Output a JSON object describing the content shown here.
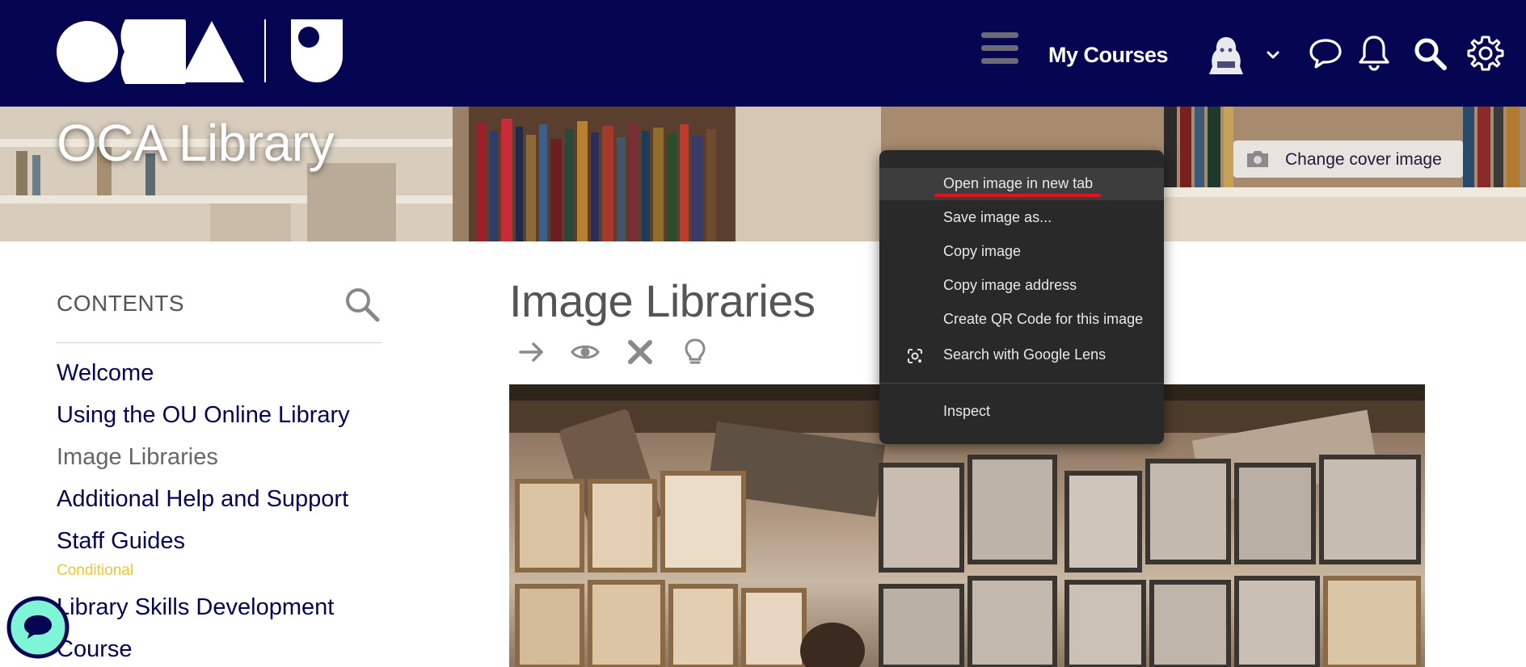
{
  "header": {
    "my_courses_label": "My Courses",
    "brand_color": "#050552"
  },
  "banner": {
    "title": "OCA Library",
    "change_cover_label": "Change cover image"
  },
  "sidebar": {
    "contents_title": "CONTENTS",
    "items": [
      {
        "label": "Welcome"
      },
      {
        "label": "Using the OU Online Library"
      },
      {
        "label": "Image Libraries",
        "current": true
      },
      {
        "label": "Additional Help and Support"
      },
      {
        "label": "Staff Guides",
        "badge": "Conditional"
      },
      {
        "label": "Library Skills Development"
      },
      {
        "label": "Course"
      }
    ]
  },
  "main": {
    "title": "Image Libraries",
    "actions": [
      "arrow-right-icon",
      "eye-icon",
      "close-icon",
      "lightbulb-icon"
    ]
  },
  "context_menu": {
    "items": [
      {
        "label": "Open image in new tab",
        "highlighted": true
      },
      {
        "label": "Save image as..."
      },
      {
        "label": "Copy image"
      },
      {
        "label": "Copy image address"
      },
      {
        "label": "Create QR Code for this image"
      },
      {
        "label": "Search with Google Lens",
        "icon": "google-lens-icon"
      },
      {
        "label": "Inspect"
      }
    ],
    "underline_color": "#e0141b"
  }
}
